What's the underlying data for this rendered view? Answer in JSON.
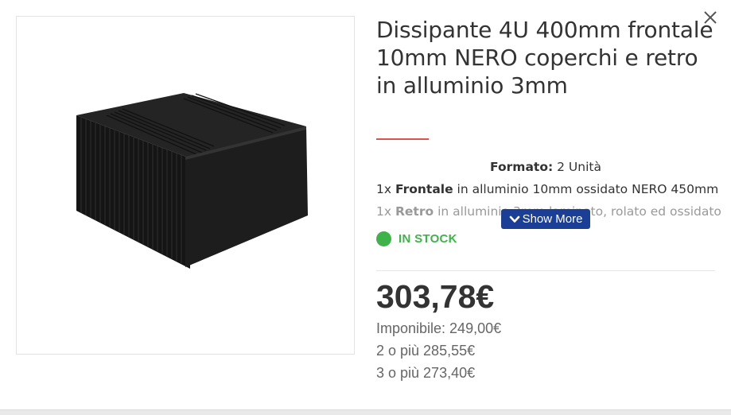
{
  "product": {
    "title": "Dissipante 4U 400mm frontale 10mm NERO coperchi e retro in alluminio 3mm",
    "image_alt": "Black aluminium heatsink enclosure"
  },
  "specs": {
    "format_label": "Formato:",
    "format_value": "2 Unità",
    "line2_prefix": "1x",
    "line2_bold": "Frontale",
    "line2_rest": "in alluminio 10mm ossidato NERO 450mm",
    "line3_prefix": "1x",
    "line3_bold": "Retro",
    "line3_rest": "in alluminio 3mm laminato, rolato ed ossidato"
  },
  "show_more": {
    "label": "Show More",
    "icon": "chevron-down-icon"
  },
  "stock": {
    "label": "IN STOCK",
    "color": "#3eb34a"
  },
  "pricing": {
    "price": "303,78€",
    "imponibile": "Imponibile: 249,00€",
    "tier_2": "2 o più 285,55€",
    "tier_3": "3 o più 273,40€"
  },
  "icons": {
    "close": "close-icon"
  },
  "colors": {
    "accent_underline": "#d9534f",
    "button_blue": "#1b3f96"
  }
}
